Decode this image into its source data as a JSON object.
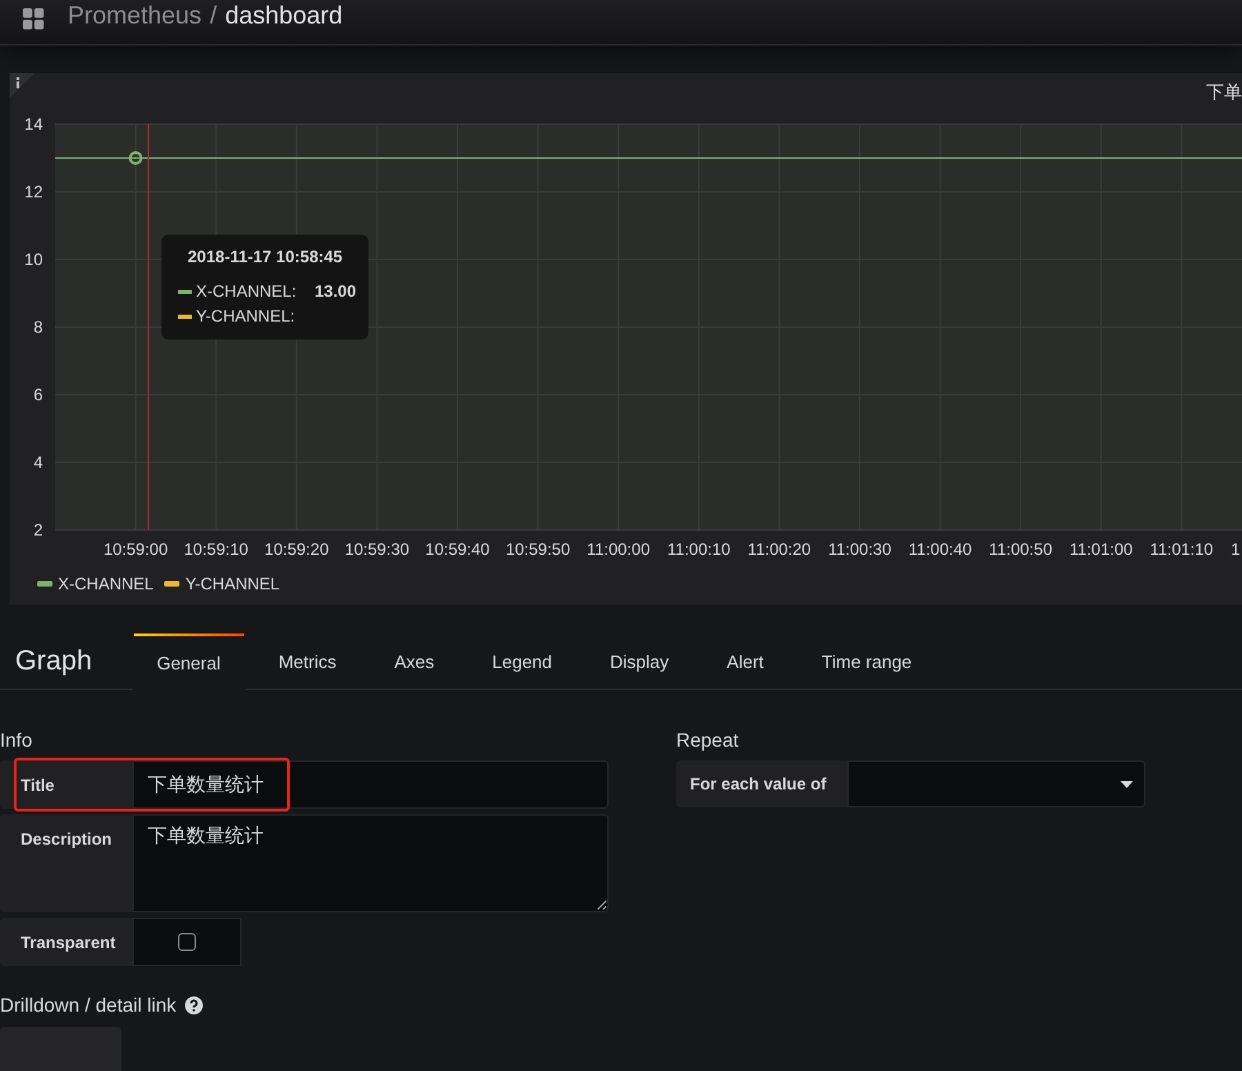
{
  "header": {
    "parent": "Prometheus",
    "separator": "/",
    "current": "dashboard"
  },
  "panel": {
    "title": "下单",
    "chart_data": {
      "type": "line",
      "grid": true,
      "categories": [
        null,
        "10:59:00",
        "10:59:10",
        "10:59:20",
        "10:59:30",
        "10:59:40",
        "10:59:50",
        "11:00:00",
        "11:00:10",
        "11:00:20",
        "11:00:30",
        "11:00:40",
        "11:00:50",
        "11:01:00",
        "11:01:10",
        null
      ],
      "ylim": [
        2,
        14
      ],
      "yticks": [
        2,
        4,
        6,
        8,
        10,
        12,
        14
      ],
      "series": [
        {
          "name": "X-CHANNEL",
          "color": "#7eb26d",
          "values": [
            13,
            13,
            13,
            13,
            13,
            13,
            13,
            13,
            13,
            13,
            13,
            13,
            13,
            13,
            13,
            13
          ]
        },
        {
          "name": "Y-CHANNEL",
          "color": "#eab839",
          "values": [
            null,
            null,
            null,
            null,
            null,
            null,
            null,
            null,
            null,
            null,
            null,
            null,
            null,
            null,
            null,
            null
          ]
        }
      ]
    },
    "cut_tick_label": "1",
    "tooltip": {
      "time": "2018-11-17 10:58:45",
      "rows": [
        {
          "name": "X-CHANNEL:",
          "color": "#7eb26d",
          "value": "13.00"
        },
        {
          "name": "Y-CHANNEL:",
          "color": "#eab839"
        }
      ]
    }
  },
  "editor": {
    "title": "Graph",
    "tabs": [
      {
        "label": "General",
        "selected": true
      },
      {
        "label": "Metrics",
        "selected": false
      },
      {
        "label": "Axes",
        "selected": false
      },
      {
        "label": "Legend",
        "selected": false
      },
      {
        "label": "Display",
        "selected": false
      },
      {
        "label": "Alert",
        "selected": false
      },
      {
        "label": "Time range",
        "selected": false
      }
    ]
  },
  "info": {
    "heading": "Info",
    "title_field": {
      "label": "Title",
      "value": "下单数量统计",
      "highlighted": true
    },
    "description_field": {
      "label": "Description",
      "value": "下单数量统计"
    },
    "transparent": {
      "label": "Transparent",
      "checked": false
    }
  },
  "repeat": {
    "heading": "Repeat",
    "label": "For each value of"
  },
  "drilldown": {
    "heading": "Drilldown / detail link"
  }
}
